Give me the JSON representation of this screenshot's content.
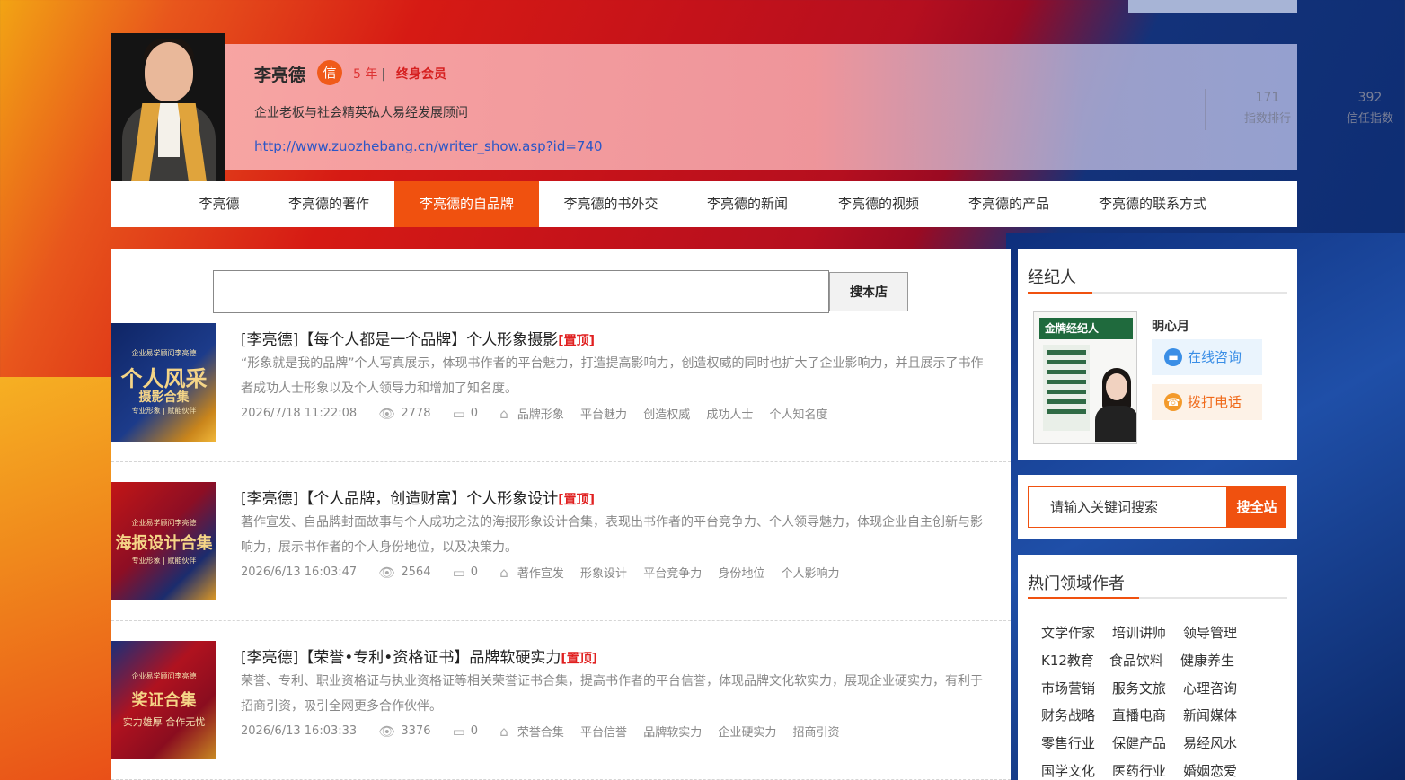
{
  "profile": {
    "name": "李亮德",
    "badge": "信",
    "years": "5 年",
    "separator": "|",
    "membership": "终身会员",
    "bio": "企业老板与社会精英私人易经发展顾问",
    "url": "http://www.zuozhebang.cn/writer_show.asp?id=740",
    "stats": [
      {
        "value": "171",
        "label": "指数排行"
      },
      {
        "value": "392",
        "label": "信任指数"
      }
    ]
  },
  "nav": {
    "items": [
      {
        "label": "李亮德"
      },
      {
        "label": "李亮德的著作"
      },
      {
        "label": "李亮德的自品牌"
      },
      {
        "label": "李亮德的书外交"
      },
      {
        "label": "李亮德的新闻"
      },
      {
        "label": "李亮德的视频"
      },
      {
        "label": "李亮德的产品"
      },
      {
        "label": "李亮德的联系方式"
      }
    ],
    "active_index": 2
  },
  "search": {
    "placeholder": "",
    "button_label": "搜本店"
  },
  "articles": [
    {
      "thumb_top": "企业易学顾问李亮德",
      "thumb_title": "个人风采",
      "thumb_sub1": "摄影合集",
      "thumb_sub2": "专业形象 | 赋能伙伴",
      "title": "[李亮德]【每个人都是一个品牌】个人形象摄影",
      "pin": "[置顶]",
      "desc": "“形象就是我的品牌”个人写真展示，体现书作者的平台魅力，打造提高影响力，创造权威的同时也扩大了企业影响力，并且展示了书作者成功人士形象以及个人领导力和增加了知名度。",
      "date": "2026/7/18 11:22:08",
      "views": "2778",
      "comments": "0",
      "tags": [
        "品牌形象",
        "平台魅力",
        "创造权威",
        "成功人士",
        "个人知名度"
      ]
    },
    {
      "thumb_top": "企业易学顾问李亮德",
      "thumb_title": "海报设计合集",
      "thumb_sub1": "",
      "thumb_sub2": "专业形象 | 赋能伙伴",
      "title": "[李亮德]【个人品牌，创造财富】个人形象设计",
      "pin": "[置顶]",
      "desc": "著作宣发、自品牌封面故事与个人成功之法的海报形象设计合集，表现出书作者的平台竞争力、个人领导魅力，体现企业自主创新与影响力，展示书作者的个人身份地位，以及决策力。",
      "date": "2026/6/13 16:03:47",
      "views": "2564",
      "comments": "0",
      "tags": [
        "著作宣发",
        "形象设计",
        "平台竞争力",
        "身份地位",
        "个人影响力"
      ]
    },
    {
      "thumb_top": "企业易学顾问李亮德",
      "thumb_title": "奖证合集",
      "thumb_sub1": "",
      "thumb_sub2": "实力雄厚 合作无忧",
      "title": "[李亮德]【荣誉•专利•资格证书】品牌软硬实力",
      "pin": "[置顶]",
      "desc": "荣誉、专利、职业资格证与执业资格证等相关荣誉证书合集，提高书作者的平台信誉，体现品牌文化软实力，展现企业硬实力，有利于招商引资，吸引全网更多合作伙伴。",
      "date": "2026/6/13 16:03:33",
      "views": "3376",
      "comments": "0",
      "tags": [
        "荣誉合集",
        "平台信誉",
        "品牌软实力",
        "企业硬实力",
        "招商引资"
      ]
    }
  ],
  "agent": {
    "heading": "经纪人",
    "card_title": "金牌经纪人",
    "name": "明心月",
    "consult_label": "在线咨询",
    "call_label": "拨打电话"
  },
  "site_search": {
    "placeholder": "请输入关键词搜索",
    "button_label": "搜全站"
  },
  "hot_authors": {
    "heading": "热门领域作者",
    "categories": [
      [
        "文学作家",
        "培训讲师",
        "领导管理"
      ],
      [
        "K12教育",
        "食品饮料",
        "健康养生"
      ],
      [
        "市场营销",
        "服务文旅",
        "心理咨询"
      ],
      [
        "财务战略",
        "直播电商",
        "新闻媒体"
      ],
      [
        "零售行业",
        "保健产品",
        "易经风水"
      ],
      [
        "国学文化",
        "医药行业",
        "婚姻恋爱"
      ]
    ]
  },
  "colors": {
    "accent": "#f0510f",
    "pin": "#e02020",
    "link": "#2b56c7"
  }
}
